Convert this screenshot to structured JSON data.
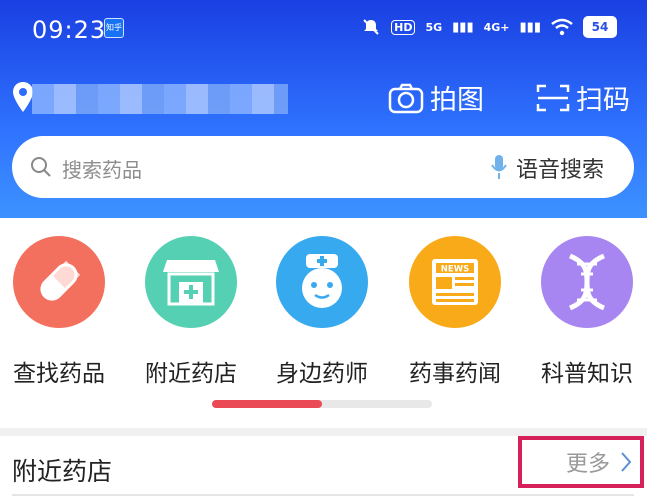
{
  "status_bar": {
    "time": "09:23",
    "app_badge": "知乎",
    "net1": "5G",
    "net2": "4G+",
    "battery": "54"
  },
  "header": {
    "photo_label": "拍图",
    "scan_label": "扫码"
  },
  "search": {
    "placeholder": "搜索药品",
    "voice_label": "语音搜索"
  },
  "categories": [
    {
      "label": "查找药品",
      "color": "#f36f5e",
      "icon": "pill-icon"
    },
    {
      "label": "附近药店",
      "color": "#55d0b3",
      "icon": "pharmacy-store-icon"
    },
    {
      "label": "身边药师",
      "color": "#36a9ef",
      "icon": "pharmacist-icon"
    },
    {
      "label": "药事药闻",
      "color": "#f9aa18",
      "icon": "news-icon"
    },
    {
      "label": "科普知识",
      "color": "#a786f1",
      "icon": "dna-icon"
    }
  ],
  "category_scroll": {
    "progress": 0.5
  },
  "nearby": {
    "title": "附近药店",
    "more_label": "更多"
  },
  "colors": {
    "header_start": "#1a3fe2",
    "header_end": "#3d92ff",
    "accent": "#e94a55",
    "highlight": "#d6205a"
  }
}
